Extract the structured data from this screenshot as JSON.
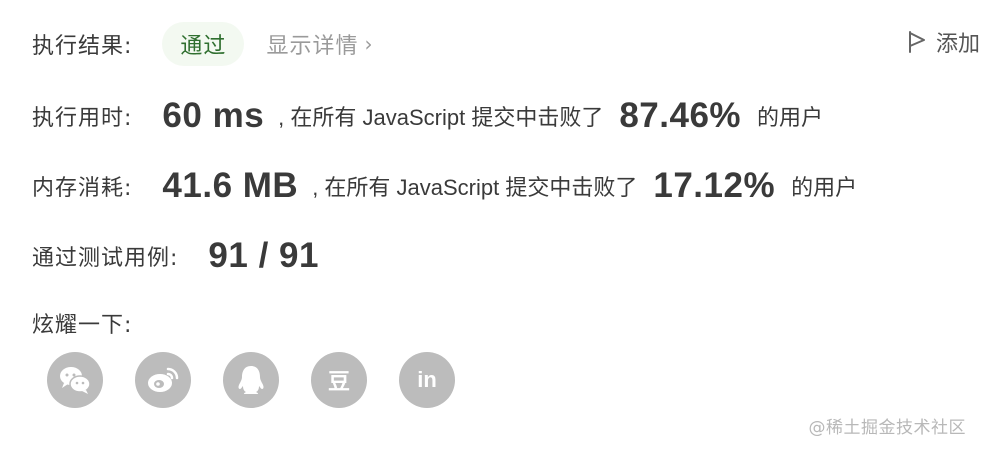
{
  "result": {
    "label": "执行结果:",
    "status": "通过",
    "details_link": "显示详情",
    "add_label": "添加"
  },
  "runtime": {
    "label": "执行用时:",
    "value": "60 ms",
    "mid_text": ", 在所有 JavaScript 提交中击败了",
    "percent": "87.46%",
    "suffix": "的用户"
  },
  "memory": {
    "label": "内存消耗:",
    "value": "41.6 MB",
    "mid_text": ", 在所有 JavaScript 提交中击败了",
    "percent": "17.12%",
    "suffix": "的用户"
  },
  "tests": {
    "label": "通过测试用例:",
    "value": "91 / 91"
  },
  "share": {
    "label": "炫耀一下:",
    "buttons": [
      {
        "icon": "wechat-icon"
      },
      {
        "icon": "weibo-icon"
      },
      {
        "icon": "qq-icon"
      },
      {
        "icon": "douban-icon",
        "glyph": "豆"
      },
      {
        "icon": "linkedin-icon",
        "glyph": "in"
      }
    ]
  },
  "watermark": "@稀土掘金技术社区",
  "colors": {
    "pass_bg": "#f3f9f1",
    "pass_text": "#2f6f2f",
    "share_icon_bg": "#bcbcbc"
  }
}
